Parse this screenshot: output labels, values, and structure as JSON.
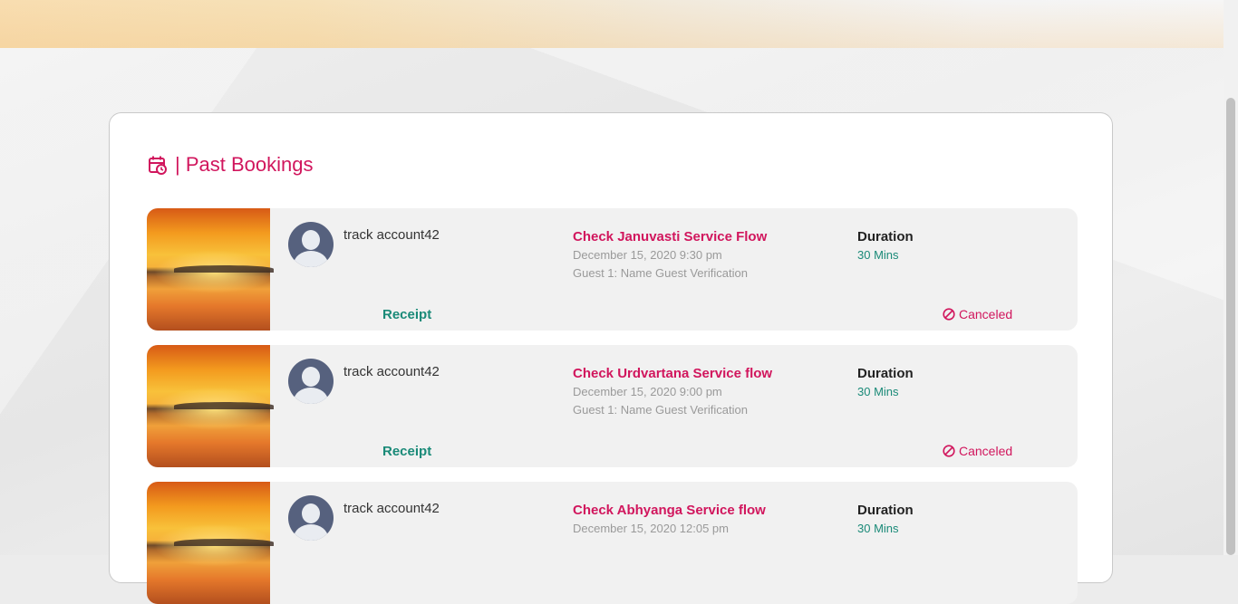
{
  "section": {
    "title": "| Past Bookings",
    "icon": "calendar-clock-icon",
    "accent_color": "#d1165d"
  },
  "bookings": [
    {
      "user_name": "track account42",
      "service_title": "Check Januvasti Service Flow",
      "date": "December 15, 2020 9:30 pm",
      "guest": "Guest 1: Name Guest Verification",
      "duration_label": "Duration",
      "duration_value": "30 Mins",
      "receipt_label": "Receipt",
      "status": "Canceled"
    },
    {
      "user_name": "track account42",
      "service_title": "Check Urdvartana Service flow",
      "date": "December 15, 2020 9:00 pm",
      "guest": "Guest 1: Name Guest Verification",
      "duration_label": "Duration",
      "duration_value": "30 Mins",
      "receipt_label": "Receipt",
      "status": "Canceled"
    },
    {
      "user_name": "track account42",
      "service_title": "Check Abhyanga Service flow",
      "date": "December 15, 2020 12:05 pm",
      "duration_label": "Duration",
      "duration_value": "30 Mins"
    }
  ]
}
